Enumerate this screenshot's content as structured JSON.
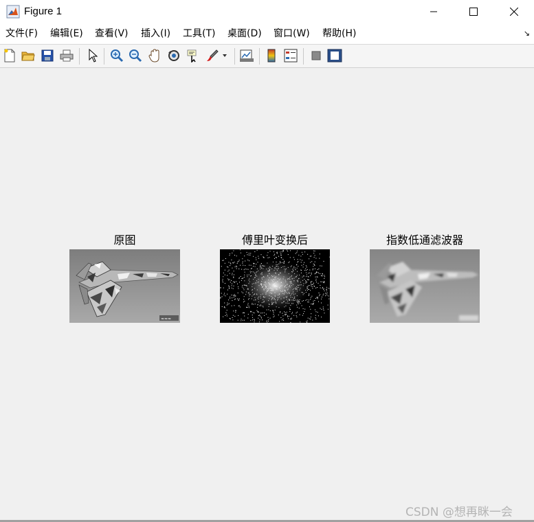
{
  "window": {
    "title": "Figure 1",
    "icon": "matlab-logo-icon"
  },
  "menu": {
    "items": [
      {
        "label": "文件(F)"
      },
      {
        "label": "编辑(E)"
      },
      {
        "label": "查看(V)"
      },
      {
        "label": "插入(I)"
      },
      {
        "label": "工具(T)"
      },
      {
        "label": "桌面(D)"
      },
      {
        "label": "窗口(W)"
      },
      {
        "label": "帮助(H)"
      }
    ]
  },
  "toolbar": {
    "buttons": [
      "new-figure-icon",
      "open-file-icon",
      "save-icon",
      "print-icon",
      "edit-plot-icon",
      "zoom-in-icon",
      "zoom-out-icon",
      "pan-icon",
      "rotate-3d-icon",
      "data-cursor-icon",
      "brush-icon",
      "link-plot-icon",
      "insert-colorbar-icon",
      "insert-legend-icon",
      "hide-plot-tools-icon",
      "show-plot-tools-icon"
    ]
  },
  "axes": [
    {
      "title": "原图"
    },
    {
      "title": "傅里叶变换后"
    },
    {
      "title": "指数低通滤波器"
    }
  ],
  "watermark": "CSDN @想再眯一会"
}
